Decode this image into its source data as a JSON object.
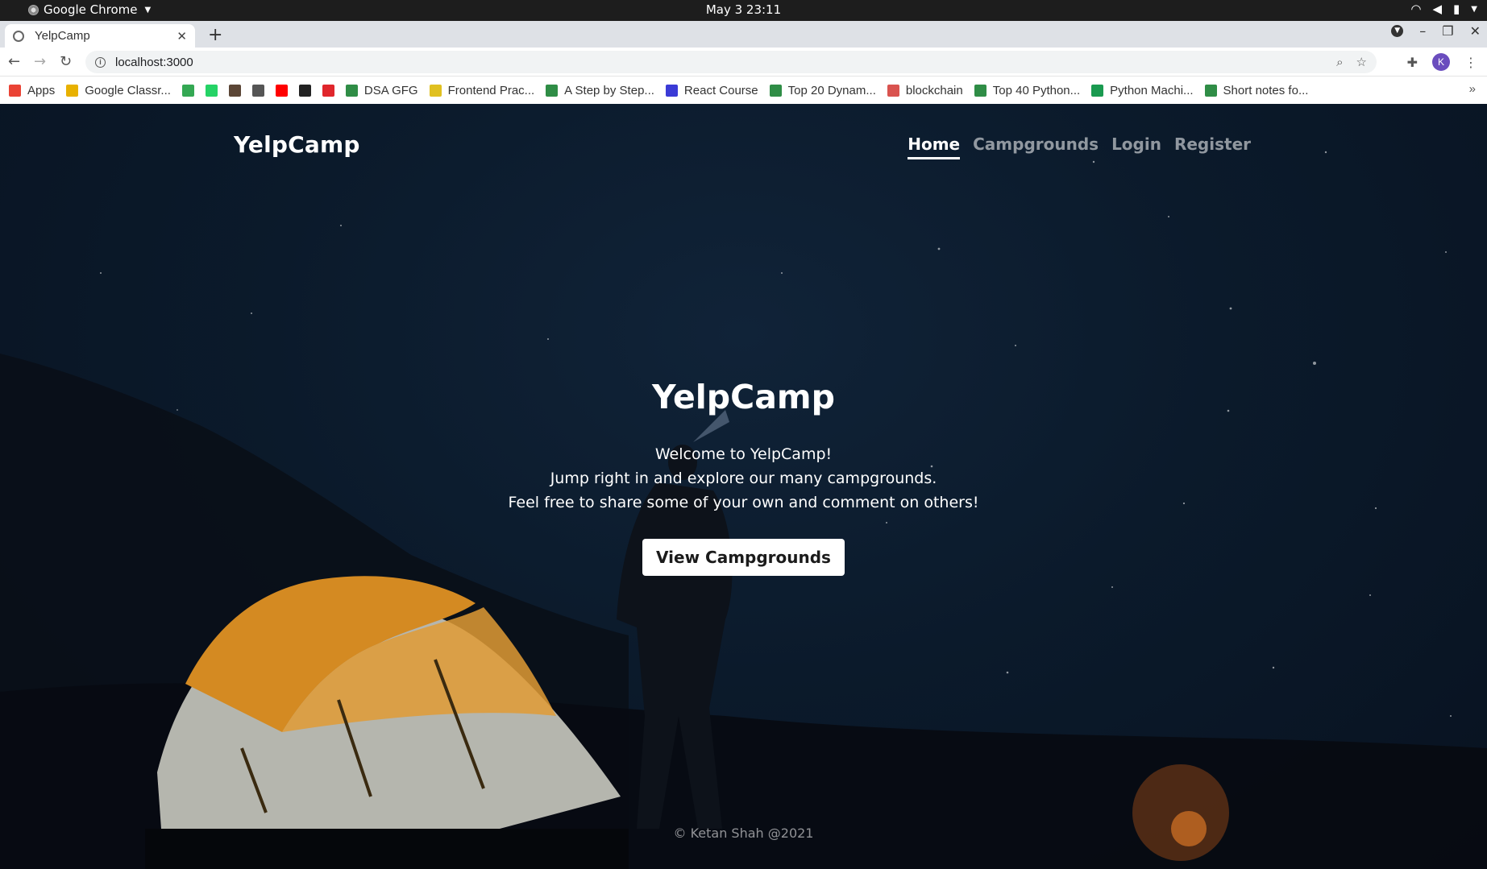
{
  "os": {
    "app_name": "Google Chrome",
    "clock": "May 3  23:11"
  },
  "browser": {
    "tab_title": "YelpCamp",
    "url": "localhost:3000",
    "avatar_letter": "K",
    "bookmarks": [
      {
        "label": "Apps",
        "icon": "apps-grid-icon",
        "color": "#ea4335"
      },
      {
        "label": "Google Classr...",
        "icon": "classroom-icon",
        "color": "#e8b100"
      },
      {
        "label": "",
        "icon": "drive-icon",
        "color": "#34a853"
      },
      {
        "label": "",
        "icon": "whatsapp-icon",
        "color": "#25d366"
      },
      {
        "label": "",
        "icon": "cc-icon",
        "color": "#5b4636"
      },
      {
        "label": "",
        "icon": "ide-icon",
        "color": "#555555"
      },
      {
        "label": "",
        "icon": "youtube-icon",
        "color": "#ff0000"
      },
      {
        "label": "",
        "icon": "github-icon",
        "color": "#222222"
      },
      {
        "label": "",
        "icon": "udemy-icon",
        "color": "#e0262c"
      },
      {
        "label": "DSA GFG",
        "icon": "gfg-icon",
        "color": "#2f8d46"
      },
      {
        "label": "Frontend Prac...",
        "icon": "crown-icon",
        "color": "#e0c020"
      },
      {
        "label": "A Step by Step...",
        "icon": "gfg-icon",
        "color": "#2f8d46"
      },
      {
        "label": "React Course",
        "icon": "c-icon",
        "color": "#3b3bd6"
      },
      {
        "label": "Top 20 Dynam...",
        "icon": "gfg-icon",
        "color": "#2f8d46"
      },
      {
        "label": "blockchain",
        "icon": "blockchain-icon",
        "color": "#d9534f"
      },
      {
        "label": "Top 40 Python...",
        "icon": "gfg-icon",
        "color": "#2f8d46"
      },
      {
        "label": "Python Machi...",
        "icon": "w-icon",
        "color": "#1a9a50"
      },
      {
        "label": "Short notes fo...",
        "icon": "gfg-icon",
        "color": "#2f8d46"
      }
    ]
  },
  "site": {
    "brand": "YelpCamp",
    "nav": [
      {
        "label": "Home",
        "active": true
      },
      {
        "label": "Campgrounds",
        "active": false
      },
      {
        "label": "Login",
        "active": false
      },
      {
        "label": "Register",
        "active": false
      }
    ],
    "hero": {
      "title": "YelpCamp",
      "line1": "Welcome to YelpCamp!",
      "line2": "Jump right in and explore our many campgrounds.",
      "line3": "Feel free to share some of your own and comment on others!",
      "button": "View Campgrounds"
    },
    "footer": "© Ketan Shah @2021"
  }
}
